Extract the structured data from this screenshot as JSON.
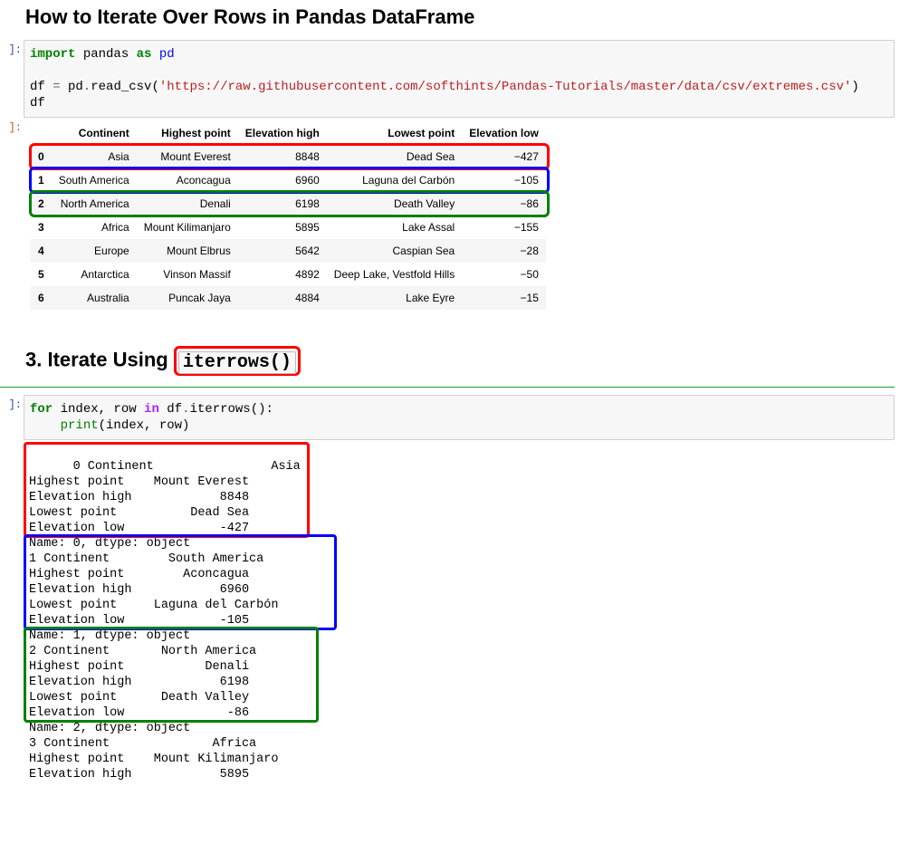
{
  "heading1": "How to Iterate Over Rows in Pandas DataFrame",
  "prompts": {
    "in": "]:",
    "out": "]:"
  },
  "code_cell_1": {
    "line1": {
      "t1": "import",
      "t2": " pandas ",
      "t3": "as",
      "t4": " pd"
    },
    "line2_blank": "",
    "line3": {
      "t1": "df ",
      "t2": "=",
      "t3": " pd",
      "t4": ".",
      "t5": "read_csv(",
      "t6": "'https://raw.githubusercontent.com/softhints/Pandas-Tutorials/master/data/csv/extremes.csv'",
      "t7": ")"
    },
    "line4": "df"
  },
  "table": {
    "columns": [
      "Continent",
      "Highest point",
      "Elevation high",
      "Lowest point",
      "Elevation low"
    ],
    "index": [
      "0",
      "1",
      "2",
      "3",
      "4",
      "5",
      "6"
    ],
    "rows": [
      [
        "Asia",
        "Mount Everest",
        "8848",
        "Dead Sea",
        "−427"
      ],
      [
        "South America",
        "Aconcagua",
        "6960",
        "Laguna del Carbón",
        "−105"
      ],
      [
        "North America",
        "Denali",
        "6198",
        "Death Valley",
        "−86"
      ],
      [
        "Africa",
        "Mount Kilimanjaro",
        "5895",
        "Lake Assal",
        "−155"
      ],
      [
        "Europe",
        "Mount Elbrus",
        "5642",
        "Caspian Sea",
        "−28"
      ],
      [
        "Antarctica",
        "Vinson Massif",
        "4892",
        "Deep Lake, Vestfold Hills",
        "−50"
      ],
      [
        "Australia",
        "Puncak Jaya",
        "4884",
        "Lake Eyre",
        "−15"
      ]
    ]
  },
  "heading2": {
    "prefix": "3. Iterate Using ",
    "code": "iterrows()"
  },
  "code_cell_2": {
    "line1": {
      "t1": "for",
      "t2": " index, row ",
      "t3": "in",
      "t4": " df",
      "t5": ".",
      "t6": "iterrows():"
    },
    "line2": {
      "pad": "    ",
      "t1": "print",
      "t2": "(index, row)"
    }
  },
  "output_text": "0 Continent                Asia\nHighest point    Mount Everest\nElevation high            8848\nLowest point          Dead Sea\nElevation low             -427\nName: 0, dtype: object\n1 Continent        South America\nHighest point        Aconcagua\nElevation high            6960\nLowest point     Laguna del Carbón\nElevation low             -105\nName: 1, dtype: object\n2 Continent       North America\nHighest point           Denali\nElevation high            6198\nLowest point      Death Valley\nElevation low              -86\nName: 2, dtype: object\n3 Continent              Africa\nHighest point    Mount Kilimanjaro\nElevation high            5895"
}
